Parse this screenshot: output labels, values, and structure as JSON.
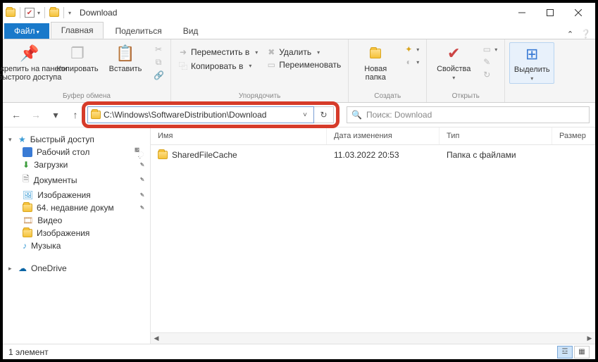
{
  "window": {
    "title": "Download"
  },
  "tabs": {
    "file": "Файл",
    "home": "Главная",
    "share": "Поделиться",
    "view": "Вид"
  },
  "ribbon": {
    "clipboard": {
      "pin": "Закрепить на панели\nбыстрого доступа",
      "copy": "Копировать",
      "paste": "Вставить",
      "label": "Буфер обмена"
    },
    "organize": {
      "move_to": "Переместить в",
      "copy_to": "Копировать в",
      "delete": "Удалить",
      "rename": "Переименовать",
      "label": "Упорядочить"
    },
    "new": {
      "new_folder": "Новая\nпапка",
      "label": "Создать"
    },
    "open": {
      "properties": "Свойства",
      "label": "Открыть"
    },
    "select": {
      "select": "Выделить",
      "label": ""
    }
  },
  "address": {
    "path": "C:\\Windows\\SoftwareDistribution\\Download"
  },
  "search": {
    "placeholder": "Поиск: Download"
  },
  "sidebar": {
    "quick_access": "Быстрый доступ",
    "items": [
      {
        "label": "Рабочий стол"
      },
      {
        "label": "Загрузки"
      },
      {
        "label": "Документы"
      },
      {
        "label": "Изображения"
      },
      {
        "label": "64. недавние докум"
      },
      {
        "label": "Видео"
      },
      {
        "label": "Изображения"
      },
      {
        "label": "Музыка"
      }
    ],
    "onedrive": "OneDrive"
  },
  "columns": {
    "name": "Имя",
    "modified": "Дата изменения",
    "type": "Тип",
    "size": "Размер"
  },
  "rows": [
    {
      "name": "SharedFileCache",
      "modified": "11.03.2022 20:53",
      "type": "Папка с файлами",
      "size": ""
    }
  ],
  "status": {
    "count": "1 элемент"
  }
}
